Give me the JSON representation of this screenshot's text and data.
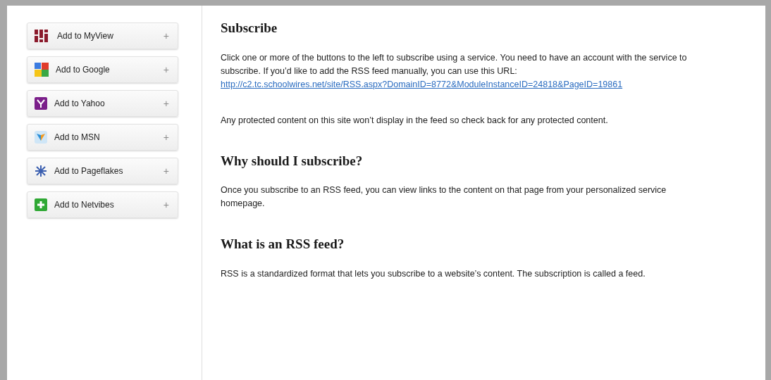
{
  "services": [
    {
      "label": "Add to MyView",
      "action": "+"
    },
    {
      "label": "Add to Google",
      "action": "+"
    },
    {
      "label": "Add to Yahoo",
      "action": "+"
    },
    {
      "label": "Add to MSN",
      "action": "+"
    },
    {
      "label": "Add to Pageflakes",
      "action": "+"
    },
    {
      "label": "Add to Netvibes",
      "action": "+"
    }
  ],
  "sections": [
    {
      "heading": "Subscribe",
      "paragraphs": [
        {
          "text": "Click one or more of the buttons to the left to subscribe using a service. You need to have an account with the service to subscribe. If you’d like to add the RSS feed manually, you can use this URL:",
          "link": "http://c2.tc.schoolwires.net/site/RSS.aspx?DomainID=8772&ModuleInstanceID=24818&PageID=19861"
        },
        {
          "text": "Any protected content on this site won’t display in the feed so check back for any protected content."
        }
      ]
    },
    {
      "heading": "Why should I subscribe?",
      "paragraphs": [
        {
          "text": "Once you subscribe to an RSS feed, you can view links to the content on that page from your personalized service homepage."
        }
      ]
    },
    {
      "heading": "What is an RSS feed?",
      "paragraphs": [
        {
          "text": "RSS is a standardized format that lets you subscribe to a website’s content. The subscription is called a feed."
        }
      ]
    }
  ]
}
